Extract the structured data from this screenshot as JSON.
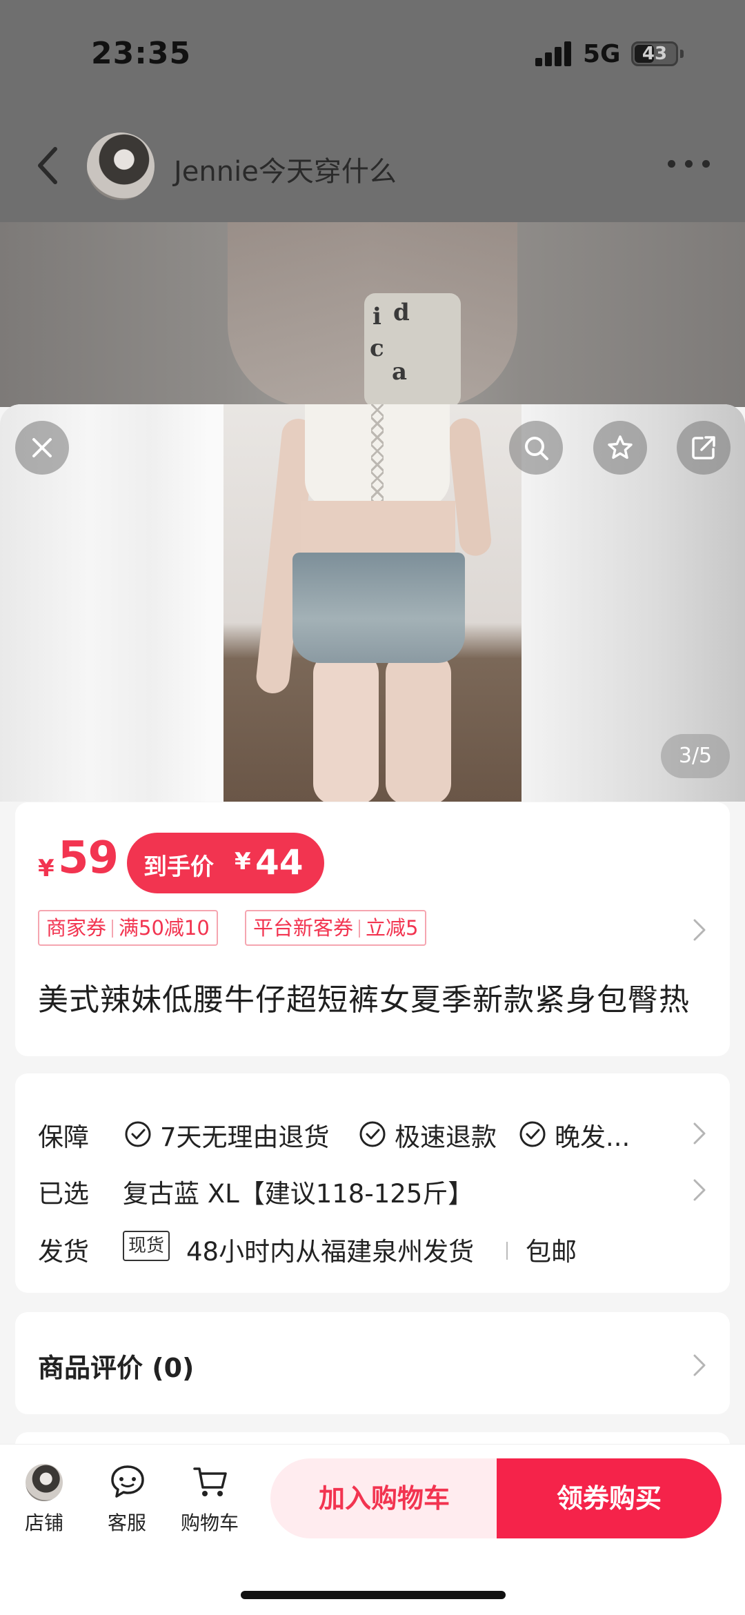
{
  "status_bar": {
    "time": "23:35",
    "network": "5G",
    "battery": "43"
  },
  "header": {
    "shop_name": "Jennie今天穿什么"
  },
  "gallery": {
    "page_indicator": "3/5"
  },
  "price": {
    "currency": "¥",
    "value": "59",
    "final_label": "到手价",
    "final_currency": "¥",
    "final_value": "44"
  },
  "coupons": [
    {
      "type": "商家券",
      "offer": "满50减10"
    },
    {
      "type": "平台新客券",
      "offer": "立减5"
    }
  ],
  "product": {
    "title": "美式辣妹低腰牛仔超短裤女夏季新款紧身包臀热"
  },
  "service": {
    "guarantee_label": "保障",
    "guarantees": [
      "7天无理由退货",
      "极速退款",
      "晚发..."
    ],
    "selected_label": "已选",
    "selected_value": "复古蓝 XL【建议118-125斤】",
    "shipping_label": "发货",
    "stock_tag": "现货",
    "shipping_info": "48小时内从福建泉州发货",
    "free_shipping": "包邮"
  },
  "reviews": {
    "title": "商品评价 (0)"
  },
  "bottom_bar": {
    "shop": "店铺",
    "service": "客服",
    "cart": "购物车",
    "add_to_cart": "加入购物车",
    "buy": "领券购买"
  },
  "colors": {
    "accent": "#f23450",
    "buy_button": "#f5234a",
    "add_cart_bg": "#ffecef"
  }
}
